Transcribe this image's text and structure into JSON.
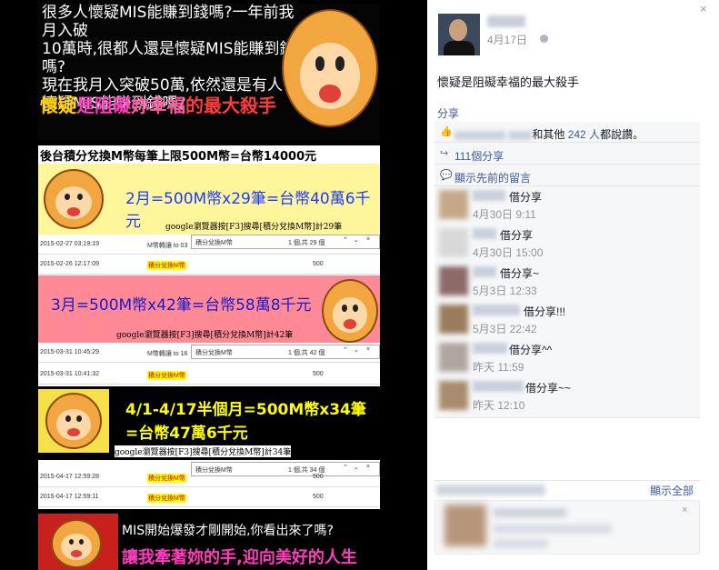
{
  "photo": {
    "intro_lines": [
      "很多人懷疑MIS能賺到錢嗎?一年前我月入破",
      "10萬時,很都人還是懷疑MIS能賺到錢嗎?",
      "現在我月入突破50萬,依然還是有人",
      "懷疑MIS能賺到錢嗎?"
    ],
    "slogan": {
      "a": "懷疑",
      "b": "是阻礙",
      "c": "妳幸福",
      "d": "的最大殺手"
    },
    "strip_heading": "後台積分兌換M幣每筆上限500M幣=台幣14000元",
    "panel1": {
      "title": "2月=500M幣x29筆=台幣40萬6千元",
      "sub": "google瀏覽器按[F3]搜尋[積分兌換M幣]計29筆"
    },
    "panel2": {
      "title": "3月=500M幣x42筆=台幣58萬8千元",
      "sub": "google瀏覽器按[F3]搜尋[積分兌換M幣]計42筆"
    },
    "panel3": {
      "title_line1": "4/1-4/17半個月=500M幣x34筆",
      "title_line2": "=台幣47萬6千元",
      "sub": "google瀏覽器按[F3]搜尋[積分兌換M幣]計34筆"
    },
    "search_term": "積分兌換M幣",
    "table1": {
      "pager": "1 個,共 29 個",
      "rows": [
        {
          "date": "2015-02-27 03:19:19",
          "desc": "M幣轉讓 to 03",
          "amount": ""
        },
        {
          "date": "2015-02-26 12:17:09",
          "desc": "積分兌換M幣",
          "amount": "500"
        }
      ]
    },
    "table2": {
      "pager": "1 個,共 42 個",
      "rows": [
        {
          "date": "2015-03-31 10:45:29",
          "desc": "M幣轉讓 to 16",
          "amount": ""
        },
        {
          "date": "2015-03-31 10:41:32",
          "desc": "積分兌換M幣",
          "amount": "500"
        }
      ]
    },
    "table3": {
      "pager": "1 個,共 34 個",
      "rows": [
        {
          "date": "2015-04-17 12:59:28",
          "desc": "積分兌換M幣",
          "amount": "500"
        },
        {
          "date": "2015-04-17 12:59:11",
          "desc": "積分兌換M幣",
          "amount": "500"
        }
      ]
    },
    "bottom_line1": "MIS開始爆發才剛開始,你看出來了嗎?",
    "bottom_line2": "讓我牽著妳的手,迎向美好的人生"
  },
  "side": {
    "close_icon": "×",
    "post_date": "4月17日",
    "post_text": "懷疑是阻礙幸福的最大殺手",
    "share_link": "分享",
    "likes": {
      "prefix": "和其他",
      "count": "242 人",
      "suffix": "都說讚。"
    },
    "shares": "111個分享",
    "prev_comments": "顯示先前的留言",
    "comments": [
      {
        "text": "借分享",
        "time": "4月30日 9:11"
      },
      {
        "text": "借分享",
        "time": "4月30日 15:00"
      },
      {
        "text": "借分享~",
        "time": "5月3日 12:33"
      },
      {
        "text": "借分享!!!",
        "time": "5月3日 22:42"
      },
      {
        "text": "借分享^^",
        "time": "昨天 11:59"
      },
      {
        "text": "借分享~~",
        "time": "昨天 12:10"
      }
    ],
    "show_all": "顯示全部",
    "sugg_close": "×"
  },
  "colors": {
    "link": "#3b5998",
    "muted": "#90949c",
    "ufi_bg": "#f6f7f9"
  }
}
